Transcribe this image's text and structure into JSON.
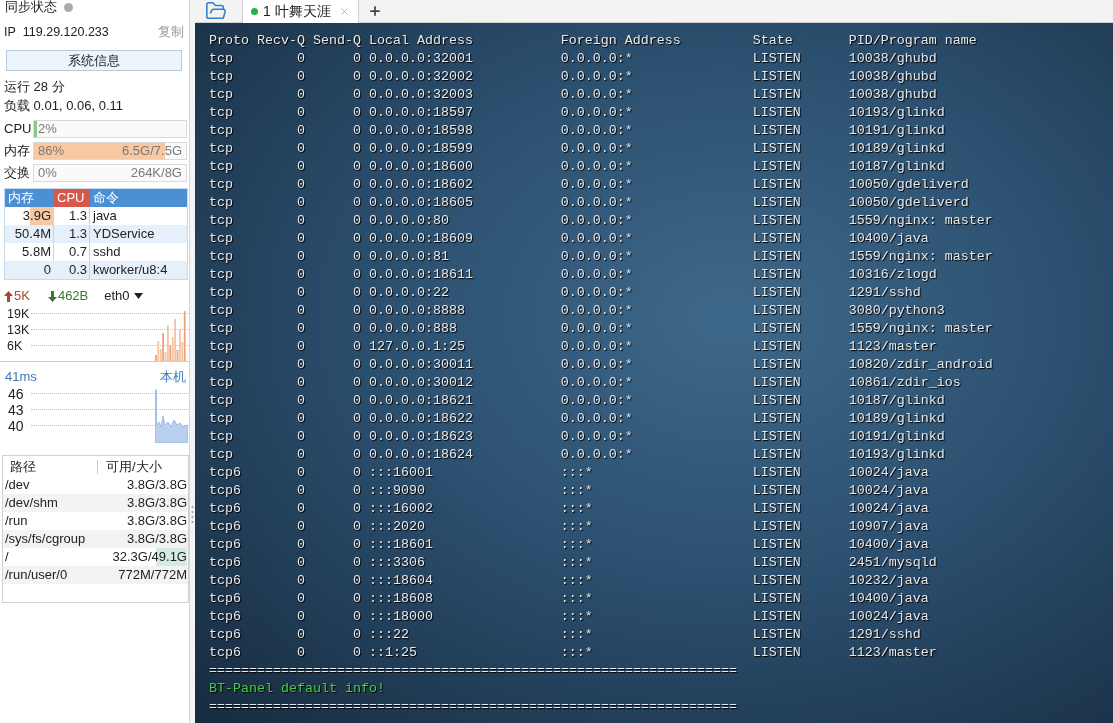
{
  "sidebar": {
    "sync_status": {
      "label": "同步状态",
      "on": false
    },
    "ip": {
      "label": "IP",
      "value": "119.29.120.233",
      "copy_label": "复制"
    },
    "system_info_button": "系统信息",
    "uptime": "运行 28 分",
    "load": "负载 0.01, 0.06, 0.11",
    "meters": [
      {
        "label": "CPU",
        "percent": "2%",
        "level": 0.02
      },
      {
        "label": "内存",
        "percent": "86%",
        "detail": "6.5G/7.5G",
        "level": 0.86
      },
      {
        "label": "交换",
        "percent": "0%",
        "detail": "264K/8G"
      }
    ],
    "processes": {
      "columns": [
        {
          "label": "内存",
          "sorted": false
        },
        {
          "label": "CPU",
          "sorted": true
        },
        {
          "label": "命令",
          "sorted": false
        }
      ],
      "rows": [
        {
          "memory": "3.9G",
          "level": 0.48,
          "cpu": "1.3",
          "command": "java"
        },
        {
          "memory": "50.4M",
          "level": 0.01,
          "cpu": "1.3",
          "command": "YDService"
        },
        {
          "memory": "5.8M",
          "level": 0.005,
          "cpu": "0.7",
          "command": "sshd"
        },
        {
          "memory": "0",
          "cpu": "0.3",
          "command": "kworker/u8:4"
        }
      ]
    },
    "network": {
      "upload": "5K",
      "download": "462B",
      "interface": "eth0",
      "axis_labels": [
        "19K",
        "13K",
        "6K"
      ]
    },
    "latency": {
      "reading": "41ms",
      "host": "本机",
      "axis_labels": [
        "46",
        "43",
        "40"
      ]
    },
    "disks": {
      "columns": [
        "路径",
        "可用/大小"
      ],
      "rows": [
        {
          "path": "/dev",
          "usage": "3.8G/3.8G"
        },
        {
          "path": "/dev/shm",
          "usage": "3.8G/3.8G"
        },
        {
          "path": "/run",
          "usage": "3.8G/3.8G"
        },
        {
          "path": "/sys/fs/cgroup",
          "usage": "3.8G/3.8G"
        },
        {
          "path": "/",
          "usage": "32.3G/49.1G",
          "level": 0.34
        },
        {
          "path": "/run/user/0",
          "usage": "772M/772M"
        }
      ]
    }
  },
  "tabs": [
    {
      "label": "1 叶舞天涯",
      "selected": true,
      "connected": true
    }
  ],
  "terminal": {
    "columns": [
      "Proto",
      "Recv-Q",
      "Send-Q",
      "Local Address",
      "Foreign Address",
      "State",
      "PID/Program name"
    ],
    "rows": [
      [
        "tcp",
        "0",
        "0",
        "0.0.0.0:32001",
        "0.0.0.0:*",
        "LISTEN",
        "10038/ghubd"
      ],
      [
        "tcp",
        "0",
        "0",
        "0.0.0.0:32002",
        "0.0.0.0:*",
        "LISTEN",
        "10038/ghubd"
      ],
      [
        "tcp",
        "0",
        "0",
        "0.0.0.0:32003",
        "0.0.0.0:*",
        "LISTEN",
        "10038/ghubd"
      ],
      [
        "tcp",
        "0",
        "0",
        "0.0.0.0:18597",
        "0.0.0.0:*",
        "LISTEN",
        "10193/glinkd"
      ],
      [
        "tcp",
        "0",
        "0",
        "0.0.0.0:18598",
        "0.0.0.0:*",
        "LISTEN",
        "10191/glinkd"
      ],
      [
        "tcp",
        "0",
        "0",
        "0.0.0.0:18599",
        "0.0.0.0:*",
        "LISTEN",
        "10189/glinkd"
      ],
      [
        "tcp",
        "0",
        "0",
        "0.0.0.0:18600",
        "0.0.0.0:*",
        "LISTEN",
        "10187/glinkd"
      ],
      [
        "tcp",
        "0",
        "0",
        "0.0.0.0:18602",
        "0.0.0.0:*",
        "LISTEN",
        "10050/gdeliverd"
      ],
      [
        "tcp",
        "0",
        "0",
        "0.0.0.0:18605",
        "0.0.0.0:*",
        "LISTEN",
        "10050/gdeliverd"
      ],
      [
        "tcp",
        "0",
        "0",
        "0.0.0.0:80",
        "0.0.0.0:*",
        "LISTEN",
        "1559/nginx: master"
      ],
      [
        "tcp",
        "0",
        "0",
        "0.0.0.0:18609",
        "0.0.0.0:*",
        "LISTEN",
        "10400/java"
      ],
      [
        "tcp",
        "0",
        "0",
        "0.0.0.0:81",
        "0.0.0.0:*",
        "LISTEN",
        "1559/nginx: master"
      ],
      [
        "tcp",
        "0",
        "0",
        "0.0.0.0:18611",
        "0.0.0.0:*",
        "LISTEN",
        "10316/zlogd"
      ],
      [
        "tcp",
        "0",
        "0",
        "0.0.0.0:22",
        "0.0.0.0:*",
        "LISTEN",
        "1291/sshd"
      ],
      [
        "tcp",
        "0",
        "0",
        "0.0.0.0:8888",
        "0.0.0.0:*",
        "LISTEN",
        "3080/python3"
      ],
      [
        "tcp",
        "0",
        "0",
        "0.0.0.0:888",
        "0.0.0.0:*",
        "LISTEN",
        "1559/nginx: master"
      ],
      [
        "tcp",
        "0",
        "0",
        "127.0.0.1:25",
        "0.0.0.0:*",
        "LISTEN",
        "1123/master"
      ],
      [
        "tcp",
        "0",
        "0",
        "0.0.0.0:30011",
        "0.0.0.0:*",
        "LISTEN",
        "10820/zdir_android"
      ],
      [
        "tcp",
        "0",
        "0",
        "0.0.0.0:30012",
        "0.0.0.0:*",
        "LISTEN",
        "10861/zdir_ios"
      ],
      [
        "tcp",
        "0",
        "0",
        "0.0.0.0:18621",
        "0.0.0.0:*",
        "LISTEN",
        "10187/glinkd"
      ],
      [
        "tcp",
        "0",
        "0",
        "0.0.0.0:18622",
        "0.0.0.0:*",
        "LISTEN",
        "10189/glinkd"
      ],
      [
        "tcp",
        "0",
        "0",
        "0.0.0.0:18623",
        "0.0.0.0:*",
        "LISTEN",
        "10191/glinkd"
      ],
      [
        "tcp",
        "0",
        "0",
        "0.0.0.0:18624",
        "0.0.0.0:*",
        "LISTEN",
        "10193/glinkd"
      ],
      [
        "tcp6",
        "0",
        "0",
        ":::16001",
        ":::*",
        "LISTEN",
        "10024/java"
      ],
      [
        "tcp6",
        "0",
        "0",
        ":::9090",
        ":::*",
        "LISTEN",
        "10024/java"
      ],
      [
        "tcp6",
        "0",
        "0",
        ":::16002",
        ":::*",
        "LISTEN",
        "10024/java"
      ],
      [
        "tcp6",
        "0",
        "0",
        ":::2020",
        ":::*",
        "LISTEN",
        "10907/java"
      ],
      [
        "tcp6",
        "0",
        "0",
        ":::18601",
        ":::*",
        "LISTEN",
        "10400/java"
      ],
      [
        "tcp6",
        "0",
        "0",
        ":::3306",
        ":::*",
        "LISTEN",
        "2451/mysqld"
      ],
      [
        "tcp6",
        "0",
        "0",
        ":::18604",
        ":::*",
        "LISTEN",
        "10232/java"
      ],
      [
        "tcp6",
        "0",
        "0",
        ":::18608",
        ":::*",
        "LISTEN",
        "10400/java"
      ],
      [
        "tcp6",
        "0",
        "0",
        ":::18000",
        ":::*",
        "LISTEN",
        "10024/java"
      ],
      [
        "tcp6",
        "0",
        "0",
        ":::22",
        ":::*",
        "LISTEN",
        "1291/sshd"
      ],
      [
        "tcp6",
        "0",
        "0",
        "::1:25",
        ":::*",
        "LISTEN",
        "1123/master"
      ]
    ],
    "lines": [
      {
        "kind": "separator",
        "text": "=================================================================="
      },
      {
        "kind": "notice",
        "text": "BT-Panel default info!"
      },
      {
        "kind": "separator",
        "text": "=================================================================="
      }
    ]
  }
}
